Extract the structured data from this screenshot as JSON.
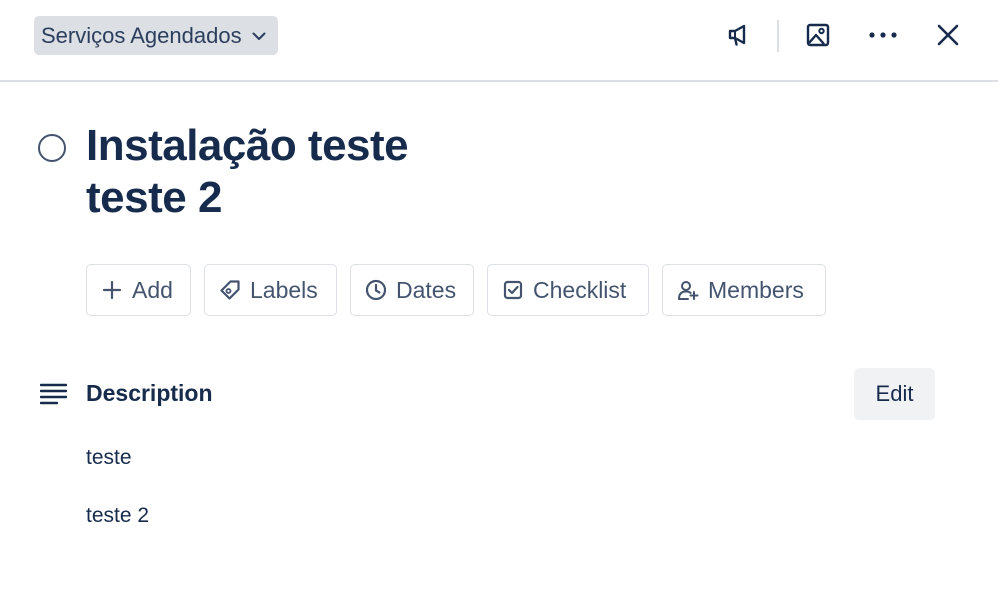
{
  "header": {
    "list_name": "Serviços Agendados",
    "icons": [
      "megaphone-icon",
      "image-icon",
      "more-icon",
      "close-icon"
    ]
  },
  "card": {
    "title_line1": "Instalação teste",
    "title_line2": "teste 2"
  },
  "actions": [
    {
      "label": "Add",
      "icon": "plus-icon"
    },
    {
      "label": "Labels",
      "icon": "tag-icon"
    },
    {
      "label": "Dates",
      "icon": "clock-icon"
    },
    {
      "label": "Checklist",
      "icon": "checklist-icon"
    },
    {
      "label": "Members",
      "icon": "member-icon"
    }
  ],
  "description": {
    "heading": "Description",
    "edit_label": "Edit",
    "lines": [
      "teste",
      "teste 2"
    ]
  },
  "colors": {
    "text": "#172b4d",
    "subtle_text": "#44546f",
    "border": "#dcdfe4",
    "selector_bg": "#dcdfe4",
    "button_bg": "#f1f2f4"
  }
}
